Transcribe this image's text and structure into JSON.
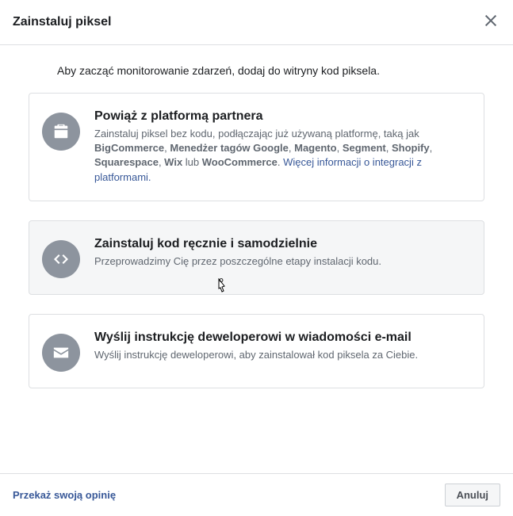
{
  "header": {
    "title": "Zainstaluj piksel"
  },
  "intro": "Aby zacząć monitorowanie zdarzeń, dodaj do witryny kod piksela.",
  "options": {
    "partner": {
      "title": "Powiąż z platformą partnera",
      "desc_pre": "Zainstaluj piksel bez kodu, podłączając już używaną platformę, taką jak ",
      "b1": "BigCommerce",
      "b2": "Menedżer tagów Google",
      "b3": "Magento",
      "b4": "Segment",
      "b5": "Shopify",
      "b6": "Squarespace",
      "b7": "Wix",
      "or": " lub ",
      "b8": "WooCommerce",
      "period": ". ",
      "link": "Więcej informacji o integracji z platformami."
    },
    "manual": {
      "title": "Zainstaluj kod ręcznie i samodzielnie",
      "desc": "Przeprowadzimy Cię przez poszczególne etapy instalacji kodu."
    },
    "email": {
      "title": "Wyślij instrukcję deweloperowi w wiadomości e-mail",
      "desc": "Wyślij instrukcję deweloperowi, aby zainstalował kod piksela za Ciebie."
    }
  },
  "footer": {
    "feedback": "Przekaż swoją opinię",
    "cancel": "Anuluj"
  },
  "sep": ", "
}
